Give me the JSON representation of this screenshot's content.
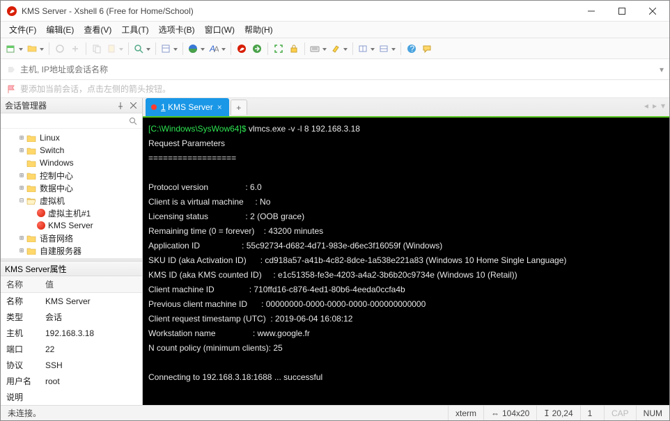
{
  "window": {
    "title": "KMS Server - Xshell 6 (Free for Home/School)"
  },
  "menus": [
    "文件(F)",
    "编辑(E)",
    "查看(V)",
    "工具(T)",
    "选项卡(B)",
    "窗口(W)",
    "帮助(H)"
  ],
  "address": {
    "placeholder": "主机, IP地址或会话名称"
  },
  "hint": "要添加当前会话，点击左侧的箭头按钮。",
  "session_manager": {
    "title": "会话管理器",
    "tree": [
      {
        "label": "Linux",
        "indent": 1,
        "exp": "⊞",
        "icon": "folder"
      },
      {
        "label": "Switch",
        "indent": 1,
        "exp": "⊞",
        "icon": "folder"
      },
      {
        "label": "Windows",
        "indent": 1,
        "exp": "",
        "icon": "folder"
      },
      {
        "label": "控制中心",
        "indent": 1,
        "exp": "⊞",
        "icon": "folder"
      },
      {
        "label": "数据中心",
        "indent": 1,
        "exp": "⊞",
        "icon": "folder"
      },
      {
        "label": "虚拟机",
        "indent": 1,
        "exp": "⊟",
        "icon": "folder-open"
      },
      {
        "label": "虚拟主机#1",
        "indent": 2,
        "exp": "",
        "icon": "session"
      },
      {
        "label": "KMS Server",
        "indent": 2,
        "exp": "",
        "icon": "session"
      },
      {
        "label": "语音网络",
        "indent": 1,
        "exp": "⊞",
        "icon": "folder"
      },
      {
        "label": "自建服务器",
        "indent": 1,
        "exp": "⊞",
        "icon": "folder"
      }
    ]
  },
  "properties": {
    "title": "KMS Server属性",
    "headers": [
      "名称",
      "值"
    ],
    "rows": [
      [
        "名称",
        "KMS Server"
      ],
      [
        "类型",
        "会话"
      ],
      [
        "主机",
        "192.168.3.18"
      ],
      [
        "端口",
        "22"
      ],
      [
        "协议",
        "SSH"
      ],
      [
        "用户名",
        "root"
      ],
      [
        "说明",
        ""
      ]
    ]
  },
  "tab": {
    "num": "1",
    "label": "KMS Server"
  },
  "terminal": {
    "prompt_path": "[C:\\Windows\\SysWow64]$",
    "command": " vlmcs.exe -v -l 8 192.168.3.18",
    "body": "\nRequest Parameters\n==================\n\nProtocol version                : 6.0\nClient is a virtual machine     : No\nLicensing status                : 2 (OOB grace)\nRemaining time (0 = forever)    : 43200 minutes\nApplication ID                  : 55c92734-d682-4d71-983e-d6ec3f16059f (Windows)\nSKU ID (aka Activation ID)      : cd918a57-a41b-4c82-8dce-1a538e221a83 (Windows 10 Home Single Language)\nKMS ID (aka KMS counted ID)     : e1c51358-fe3e-4203-a4a2-3b6b20c9734e (Windows 10 (Retail))\nClient machine ID               : 710ffd16-c876-4ed1-80b6-4eeda0ccfa4b\nPrevious client machine ID      : 00000000-0000-0000-0000-000000000000\nClient request timestamp (UTC)  : 2019-06-04 16:08:12\nWorkstation name                : www.google.fr\nN count policy (minimum clients): 25\n\nConnecting to 192.168.3.18:1688 ... successful\n"
  },
  "status": {
    "conn": "未连接。",
    "term": "xterm",
    "size": "104x20",
    "cursor": "20,24",
    "rows": "1",
    "cap": "CAP",
    "num": "NUM"
  }
}
